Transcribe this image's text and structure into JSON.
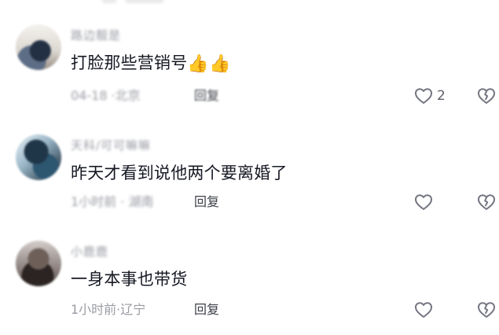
{
  "comments": [
    {
      "username": "路边靓是",
      "text": "打脸那些营销号",
      "emojis": [
        "👍",
        "👍"
      ],
      "meta": "04-18 ·北京",
      "reply_label": "回复",
      "like_count": "2",
      "like_icon": "heart-outline-icon",
      "dislike_icon": "broken-heart-icon"
    },
    {
      "username": "天科/可可嘛嘛",
      "text": "昨天才看到说他两个要离婚了",
      "emojis": [],
      "meta": "1小时前 · 湖南",
      "reply_label": "回复",
      "like_count": "",
      "like_icon": "heart-outline-icon",
      "dislike_icon": "broken-heart-icon"
    },
    {
      "username": "小鹿鹿",
      "text": "一身本事也带货",
      "emojis": [],
      "meta": "1小时前·辽宁",
      "reply_label": "回复",
      "like_count": "",
      "like_icon": "heart-outline-icon",
      "dislike_icon": "broken-heart-icon"
    }
  ],
  "colors": {
    "primary_text": "#161823",
    "secondary_text": "#9a9ca3",
    "icon_gray": "#737580",
    "background": "#ffffff"
  }
}
